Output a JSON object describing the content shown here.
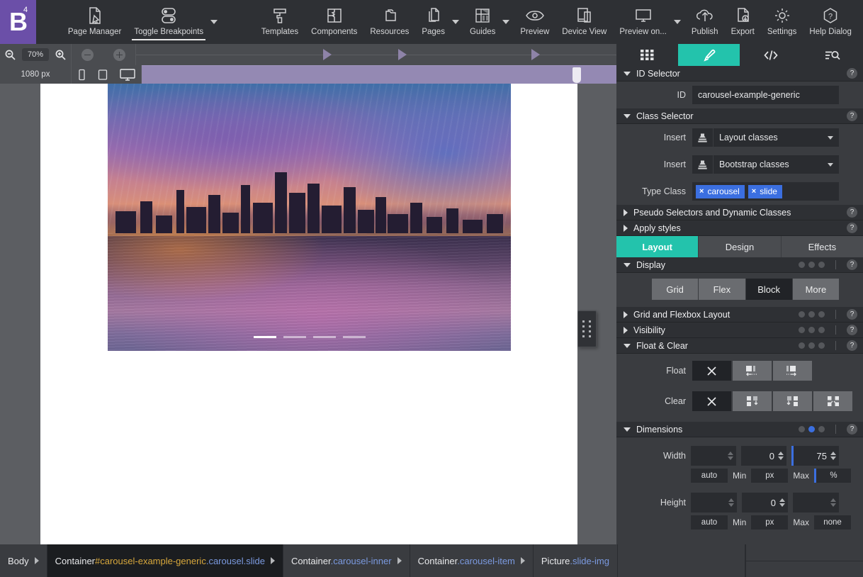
{
  "app": {
    "logo_letter": "B",
    "logo_superscript": "4"
  },
  "toolbar": {
    "items": [
      {
        "label": "Page Manager",
        "icon": "page-manager-icon",
        "active": false,
        "caret": false
      },
      {
        "label": "Toggle Breakpoints",
        "icon": "toggle-breakpoints-icon",
        "active": true,
        "caret": true
      },
      {
        "label": "Templates",
        "icon": "templates-icon",
        "active": false,
        "caret": false
      },
      {
        "label": "Components",
        "icon": "components-icon",
        "active": false,
        "caret": false
      },
      {
        "label": "Resources",
        "icon": "resources-icon",
        "active": false,
        "caret": false
      },
      {
        "label": "Pages",
        "icon": "pages-icon",
        "active": false,
        "caret": true
      },
      {
        "label": "Guides",
        "icon": "guides-icon",
        "active": false,
        "caret": true
      },
      {
        "label": "Preview",
        "icon": "eye-icon",
        "active": false,
        "caret": false
      },
      {
        "label": "Device View",
        "icon": "device-view-icon",
        "active": false,
        "caret": false
      },
      {
        "label": "Preview on...",
        "icon": "monitor-icon",
        "active": false,
        "caret": true
      },
      {
        "label": "Publish",
        "icon": "publish-cloud-icon",
        "active": false,
        "caret": false
      },
      {
        "label": "Export",
        "icon": "export-icon",
        "active": false,
        "caret": false
      },
      {
        "label": "Settings",
        "icon": "gear-icon",
        "active": false,
        "caret": false
      },
      {
        "label": "Help Dialog",
        "icon": "help-hexagon-icon",
        "active": false,
        "caret": false
      }
    ]
  },
  "zoombar": {
    "zoom_out_icon": "zoom-out-icon",
    "zoom_in_icon": "zoom-in-icon",
    "zoom_level": "70%",
    "minus_icon": "minus-circle-icon",
    "plus_icon": "plus-circle-icon",
    "breakpoint_width": "1080 px",
    "device_icons": [
      "phone-icon",
      "tablet-icon",
      "desktop-icon"
    ],
    "active_device": "desktop-icon"
  },
  "canvas": {
    "carousel_indicators": 4,
    "active_indicator": 0,
    "drag_handle_icon": "drag-dots-icon"
  },
  "right_panel": {
    "tabs": [
      {
        "icon": "grid-icon",
        "active": false
      },
      {
        "icon": "brush-icon",
        "active": true
      },
      {
        "icon": "code-icon",
        "active": false
      },
      {
        "icon": "list-search-icon",
        "active": false
      }
    ],
    "id_selector": {
      "title": "ID Selector",
      "help": "?",
      "id_label": "ID",
      "id_value": "carousel-example-generic"
    },
    "class_selector": {
      "title": "Class Selector",
      "help": "?",
      "insert_label_1": "Insert",
      "insert_value_1": "Layout classes",
      "insert_label_2": "Insert",
      "insert_value_2": "Bootstrap classes",
      "type_class_label": "Type Class",
      "chips": [
        "carousel",
        "slide"
      ],
      "chip_remove_glyph": "×",
      "stamp_icon": "stamp-icon"
    },
    "pseudo_selectors": {
      "title": "Pseudo Selectors and Dynamic Classes",
      "help": "?"
    },
    "apply_styles": {
      "title": "Apply styles",
      "help": "?"
    },
    "style_tabs": [
      {
        "label": "Layout",
        "active": true
      },
      {
        "label": "Design",
        "active": false
      },
      {
        "label": "Effects",
        "active": false
      }
    ],
    "display": {
      "title": "Display",
      "help": "?",
      "buttons": [
        {
          "label": "Grid",
          "selected": false
        },
        {
          "label": "Flex",
          "selected": false
        },
        {
          "label": "Block",
          "selected": true
        },
        {
          "label": "More",
          "selected": false
        }
      ]
    },
    "grid_flexbox": {
      "title": "Grid and Flexbox Layout",
      "help": "?"
    },
    "visibility": {
      "title": "Visibility",
      "help": "?"
    },
    "float_clear": {
      "title": "Float & Clear",
      "help": "?",
      "float_label": "Float",
      "float_options": [
        {
          "icon": "none-x-icon",
          "selected": true
        },
        {
          "icon": "float-left-icon",
          "selected": false
        },
        {
          "icon": "float-right-icon",
          "selected": false
        }
      ],
      "clear_label": "Clear",
      "clear_options": [
        {
          "icon": "none-x-icon",
          "selected": true
        },
        {
          "icon": "clear-left-icon",
          "selected": false
        },
        {
          "icon": "clear-right-icon",
          "selected": false
        },
        {
          "icon": "clear-both-icon",
          "selected": false
        }
      ]
    },
    "dimensions": {
      "title": "Dimensions",
      "help": "?",
      "active_dot_index": 1,
      "width": {
        "label": "Width",
        "value": "",
        "min_value": "0",
        "max_value": "75",
        "auto_label": "auto",
        "min_label": "Min",
        "min_unit": "px",
        "max_label": "Max",
        "max_unit": "%"
      },
      "height": {
        "label": "Height",
        "value": "",
        "min_value": "0",
        "max_value": "",
        "auto_label": "auto",
        "min_label": "Min",
        "min_unit": "px",
        "max_label": "Max",
        "max_unit": "none"
      }
    }
  },
  "breadcrumb": [
    {
      "tag": "Body",
      "hash": "",
      "classes": "",
      "selected": false,
      "arrow": true
    },
    {
      "tag": "Container",
      "hash": "#carousel-example-generic",
      "classes": ".carousel.slide",
      "selected": true,
      "arrow": true
    },
    {
      "tag": "Container",
      "hash": "",
      "classes": ".carousel-inner",
      "selected": false,
      "arrow": true
    },
    {
      "tag": "Container",
      "hash": "",
      "classes": ".carousel-item",
      "selected": false,
      "arrow": true
    },
    {
      "tag": "Picture",
      "hash": "",
      "classes": ".slide-img",
      "selected": false,
      "arrow": false
    }
  ],
  "colors": {
    "accent_teal": "#23c3ac",
    "logo_purple": "#6b4fa8",
    "chip_blue": "#3b6fe0",
    "breakpoint_purple": "#9489b3",
    "panel_bg": "#3a3c40",
    "toolbar_bg": "#2e3034"
  }
}
